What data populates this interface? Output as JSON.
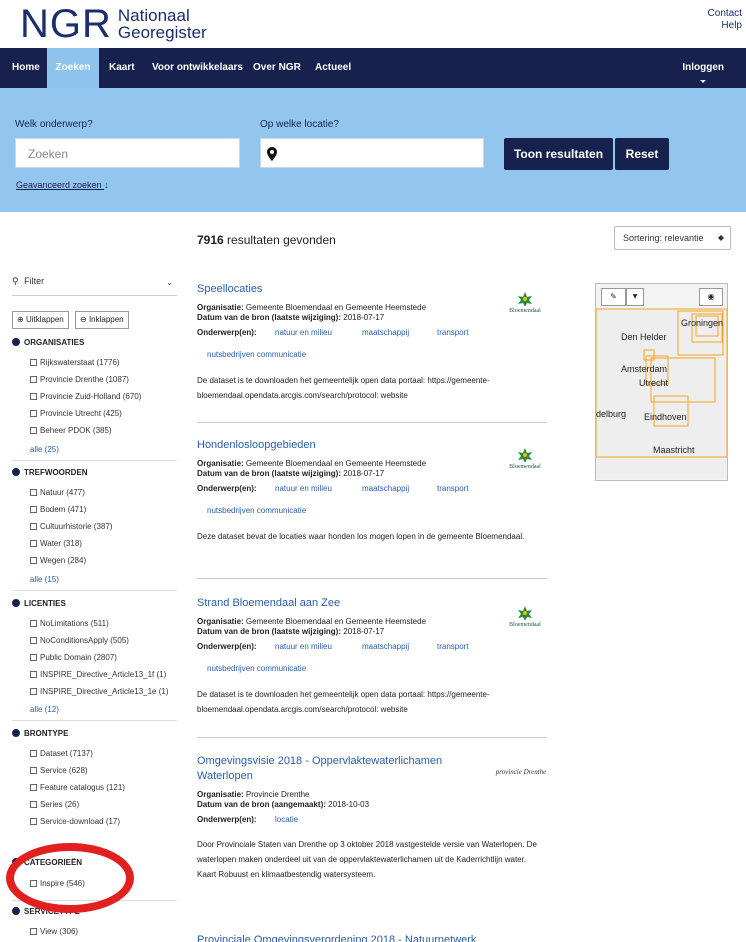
{
  "header": {
    "logo_ngr": "NGR",
    "logo_line1": "Nationaal",
    "logo_line2": "Georegister",
    "contact": "Contact",
    "help": "Help"
  },
  "nav": {
    "items": [
      "Home",
      "Zoeken",
      "Kaart",
      "Voor ontwikkelaars",
      "Over NGR",
      "Actueel"
    ],
    "login": "Inloggen"
  },
  "search": {
    "subject_label": "Welk onderwerp?",
    "subject_placeholder": "Zoeken",
    "location_label": "Op welke locatie?",
    "show_results": "Toon resultaten",
    "reset": "Reset",
    "advanced": "Geavanceerd zoeken"
  },
  "results_header": {
    "count": "7916",
    "count_suffix": " resultaten gevonden",
    "sort": "Sortering: relevantie"
  },
  "sidebar": {
    "filter": "Filter",
    "expand": "Uitklappen",
    "collapse": "Inklappen",
    "facets": [
      {
        "title": "ORGANISATIES",
        "items": [
          "Rijkswaterstaat (1776)",
          "Provincie Drenthe (1087)",
          "Provincie Zuid-Holland (670)",
          "Provincie Utrecht (425)",
          "Beheer PDOK (385)"
        ],
        "more": "alle (25)"
      },
      {
        "title": "TREFWOORDEN",
        "items": [
          "Natuur (477)",
          "Bodem (471)",
          "Cultuurhistorie (387)",
          "Water (318)",
          "Wegen (284)"
        ],
        "more": "alle (15)"
      },
      {
        "title": "LICENTIES",
        "items": [
          "NoLimitations (511)",
          "NoConditionsApply (505)",
          "Public Domain (2807)",
          "INSPIRE_Directive_Article13_1f (1)",
          "INSPIRE_Directive_Article13_1e (1)"
        ],
        "more": "alle (12)"
      },
      {
        "title": "BRONTYPE",
        "items": [
          "Dataset (7137)",
          "Service (628)",
          "Feature catalogus (121)",
          "Series (26)",
          "Service-download (17)"
        ],
        "more": ""
      },
      {
        "title": "CATEGORIEËN",
        "items": [
          "Inspire (546)"
        ],
        "more": ""
      },
      {
        "title": "SERVICETYPE",
        "items": [
          "View (306)"
        ],
        "more": ""
      }
    ]
  },
  "results": [
    {
      "title": "Speellocaties",
      "org_label": "Organisatie:",
      "org": "Gemeente Bloemendaal en Gemeente Heemstede",
      "date_label": "Datum van de bron (laatste wijziging):",
      "date": "2018-07-17",
      "subject_label": "Onderwerp(en):",
      "tags": [
        "natuur en milieu",
        "maatschappij",
        "transport",
        "nutsbedrijven communicatie"
      ],
      "desc": "De dataset is te downloaden het gemeentelijk open data portaal: https://gemeente-bloemendaal.opendata.arcgis.com/search/protocol: website",
      "logo": "Bloemendaal"
    },
    {
      "title": "Hondenlosloopgebieden",
      "org_label": "Organisatie:",
      "org": "Gemeente Bloemendaal en Gemeente Heemstede",
      "date_label": "Datum van de bron (laatste wijziging):",
      "date": "2018-07-17",
      "subject_label": "Onderwerp(en):",
      "tags": [
        "natuur en milieu",
        "maatschappij",
        "transport",
        "nutsbedrijven communicatie"
      ],
      "desc": "Deze dataset bevat de locaties waar honden los mogen lopen in de gemeente Bloemendaal.",
      "logo": "Bloemendaal"
    },
    {
      "title": "Strand Bloemendaal aan Zee",
      "org_label": "Organisatie:",
      "org": "Gemeente Bloemendaal en Gemeente Heemstede",
      "date_label": "Datum van de bron (laatste wijziging):",
      "date": "2018-07-17",
      "subject_label": "Onderwerp(en):",
      "tags": [
        "natuur en milieu",
        "maatschappij",
        "transport",
        "nutsbedrijven communicatie"
      ],
      "desc": "De dataset is te downloaden het gemeentelijk open data portaal: https://gemeente-bloemendaal.opendata.arcgis.com/search/protocol: website",
      "logo": "Bloemendaal"
    },
    {
      "title": "Omgevingsvisie 2018 - Oppervlaktewaterlichamen Waterlopen",
      "org_label": "Organisatie:",
      "org": "Provincie Drenthe",
      "date_label": "Datum van de bron (aangemaakt):",
      "date": "2018-10-03",
      "subject_label": "Onderwerp(en):",
      "tags": [
        "locatie"
      ],
      "desc": "Door Provinciale Staten van Drenthe op 3 oktober 2018 vastgestelde versie van Waterlopen. De waterlopen maken onderdeel uit van de oppervlaktewaterlichamen uit de Kaderrichtlijn water. Kaart Robuust en klimaatbestendig watersysteem.",
      "logo": "provincie Drenthe"
    },
    {
      "title": "Provinciale Omgevingsverordening 2018 - Natuurnetwerk"
    }
  ],
  "map": {
    "labels": [
      "Den Helder",
      "Groningen",
      "Amsterdam",
      "Utrecht",
      "delburg",
      "Eindhoven",
      "Maastricht"
    ]
  },
  "colors": {
    "nav_bg": "#16214e",
    "search_band": "#93c6ef",
    "link": "#2a5ea8",
    "annotation": "#e32020",
    "map_bbox": "#f5a623"
  }
}
